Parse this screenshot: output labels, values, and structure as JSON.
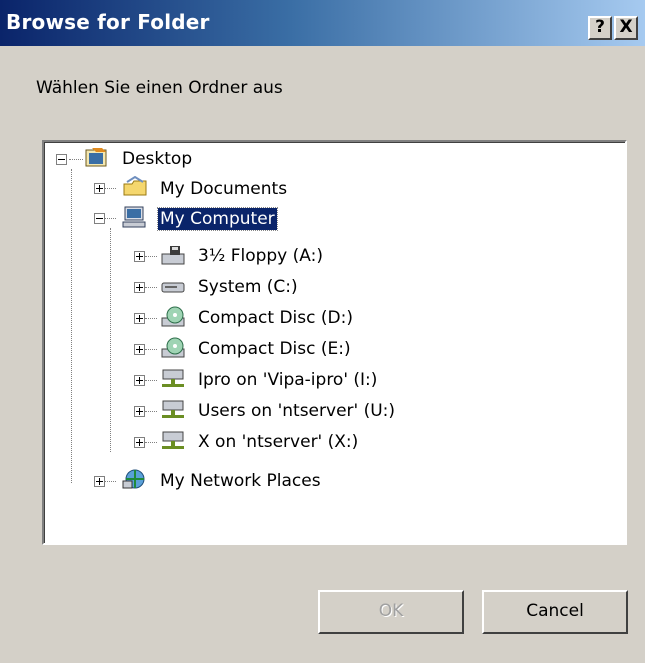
{
  "window": {
    "title": "Browse for Folder",
    "help_label": "?",
    "close_label": "X"
  },
  "prompt": "Wählen Sie einen Ordner aus",
  "tree": {
    "desktop": "Desktop",
    "my_documents": "My Documents",
    "my_computer": "My Computer",
    "floppy": "3½ Floppy (A:)",
    "system_c": "System (C:)",
    "cd_d": "Compact Disc (D:)",
    "cd_e": "Compact Disc (E:)",
    "ipro_i": "Ipro on 'Vipa-ipro' (I:)",
    "users_u": "Users on 'ntserver' (U:)",
    "x_x": "X on 'ntserver' (X:)",
    "network": "My Network Places"
  },
  "buttons": {
    "ok": "OK",
    "cancel": "Cancel"
  },
  "colors": {
    "title_start": "#0a246a",
    "title_end": "#a6caf0",
    "selection": "#0a246a",
    "face": "#d4d0c8"
  }
}
